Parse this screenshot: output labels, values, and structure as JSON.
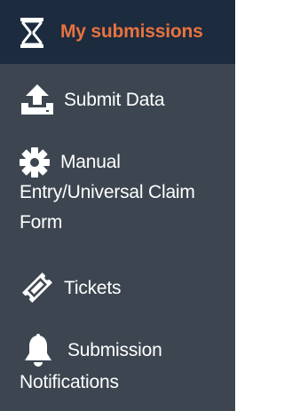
{
  "colors": {
    "sidebar_bg": "#3d4650",
    "active_bg": "#1c2b3e",
    "active_text": "#e8733f",
    "text": "#ffffff"
  },
  "nav": {
    "items": [
      {
        "label": "My submissions",
        "icon": "hourglass-icon",
        "active": true
      },
      {
        "label": "Submit Data",
        "icon": "upload-icon",
        "active": false
      },
      {
        "label_lines": [
          "Manual",
          "Entry/Universal Claim",
          "Form"
        ],
        "icon": "gear-icon",
        "active": false
      },
      {
        "label": "Tickets",
        "icon": "ticket-icon",
        "active": false
      },
      {
        "label_lines": [
          "Submission",
          "Notifications"
        ],
        "icon": "bell-icon",
        "active": false
      }
    ]
  }
}
